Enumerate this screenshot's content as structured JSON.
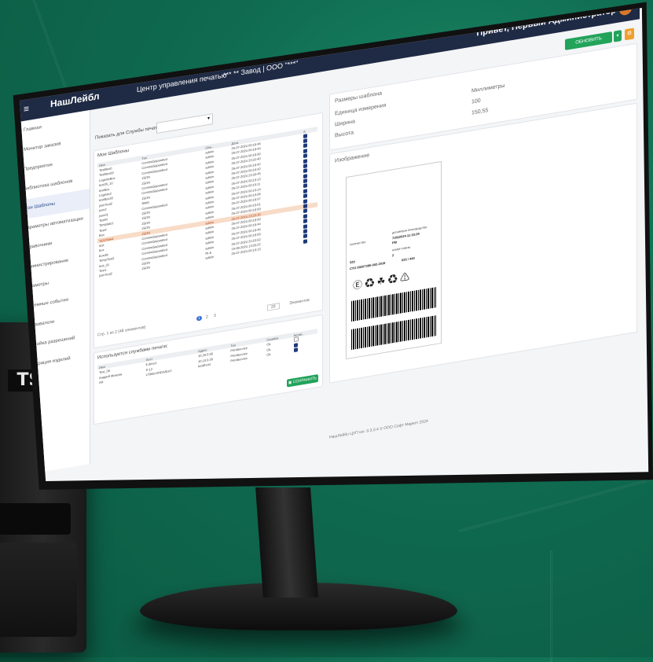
{
  "topbar": {
    "menu_icon": "≡",
    "brand": "НашЛейбл",
    "center": "Центр управления печатью",
    "plant": "*** ** Завод | ООО \"***\"",
    "greeting": "Привет, Первый Администратор"
  },
  "sidebar": {
    "items": [
      {
        "label": "Главная"
      },
      {
        "label": "Монитор заказов"
      },
      {
        "label": "Предприятие"
      },
      {
        "label": "Библиотека шаблонов"
      },
      {
        "label": "Мои Шаблоны"
      },
      {
        "label": "Параметры автоматизации"
      },
      {
        "label": "Справочники"
      },
      {
        "label": "Администрирование"
      },
      {
        "label": "Параметры"
      },
      {
        "label": "Системные события"
      },
      {
        "label": "Пользователи"
      },
      {
        "label": "Настройка разрешений"
      },
      {
        "label": "Регистрация изделий"
      }
    ]
  },
  "toolbar": {
    "update_label": "ОБНОВИТЬ",
    "dropdown": "▾",
    "gear": "⚙"
  },
  "filter": {
    "label": "Показать для Службы печати:",
    "value": ""
  },
  "templates": {
    "title": "Мои Шаблоны",
    "columns": [
      "Имя",
      "Тип",
      "Обн...",
      "Дата",
      "А"
    ],
    "rows": [
      {
        "name": "TestBox0",
        "type": "CommaSeparated",
        "user": "admin",
        "date": "25-07-2024 00:18:46",
        "active": true
      },
      {
        "name": "TestBox00",
        "type": "CommaSeparated",
        "user": "admin",
        "date": "25-07-2024 00:18:44",
        "active": true
      },
      {
        "name": "LogisticBox",
        "type": "CommaSeparated",
        "user": "admin",
        "date": "25-07-2024 00:18:50",
        "active": true
      },
      {
        "name": "test26_10",
        "type": "JSON",
        "user": "admin",
        "date": "25-07-2024 23:22:40",
        "active": true
      },
      {
        "name": "testBox",
        "type": "JSON",
        "user": "admin",
        "date": "25-07-2024 00:18:42",
        "active": true
      },
      {
        "name": "Logistic2",
        "type": "CommaSeparated",
        "user": "admin",
        "date": "25-07-2024 00:18:42",
        "active": true
      },
      {
        "name": "testBox30",
        "type": "CommaSeparated",
        "user": "admin",
        "date": "25-07-2024 23:33:45",
        "active": true
      },
      {
        "name": "jsonTest2",
        "type": "JSON",
        "user": "admin",
        "date": "25-07-2024 00:19:13",
        "active": true
      },
      {
        "name": "json2",
        "type": "Static",
        "user": "admin",
        "date": "25-07-2024 00:19:11",
        "active": true
      },
      {
        "name": "json01",
        "type": "CommaSeparated",
        "user": "admin",
        "date": "25-07-2024 00:19:14",
        "active": true
      },
      {
        "name": "TestM",
        "type": "JSON",
        "user": "admin",
        "date": "25-07-2024 00:19:06",
        "active": true
      },
      {
        "name": "Template1",
        "type": "JSON",
        "user": "admin",
        "date": "25-07-2024 00:18:57",
        "active": true
      },
      {
        "name": "Test4",
        "type": "JSON",
        "user": "admin",
        "date": "25-07-2024 00:19:01",
        "active": true
      },
      {
        "name": "Box",
        "type": "JSON",
        "user": "admin",
        "date": "25-07-2024 00:18:59",
        "active": true
      },
      {
        "name": "TESTMA4",
        "type": "JSON",
        "user": "admin",
        "date": "25-07-2024 23:23:30",
        "active": true,
        "highlight": true
      },
      {
        "name": "test",
        "type": "CommaSeparated",
        "user": "admin",
        "date": "25-07-2024 00:18:50",
        "active": true
      },
      {
        "name": "box",
        "type": "CommaSeparated",
        "user": "admin",
        "date": "25-07-2024 00:18:44",
        "active": true
      },
      {
        "name": "boxdle",
        "type": "CommaSeparated",
        "user": "admin",
        "date": "25-07-2024 00:18:46",
        "active": true
      },
      {
        "name": "TempTest2",
        "type": "CommaSeparated",
        "user": "admin",
        "date": "25-07-2024 00:18:59",
        "active": true
      },
      {
        "name": "test_01",
        "type": "CommaSeparated",
        "user": "admin",
        "date": "25-07-2024 23:23:52",
        "active": true
      },
      {
        "name": "Test1",
        "type": "JSON",
        "user": "NLS",
        "date": "19-08-2024 13:03:22",
        "active": true
      },
      {
        "name": "jsonTest2",
        "type": "JSON",
        "user": "admin",
        "date": "25-07-2024 00:19:13",
        "active": true
      }
    ],
    "pager": {
      "summary": "Стр. 1 из 2 (48 элементов)",
      "pages": [
        "1",
        "2",
        "3"
      ],
      "size": "20",
      "size_label": "Элементов"
    }
  },
  "services": {
    "title": "Используется службами печати:",
    "columns": [
      "Имя",
      "Хост",
      "Адрес",
      "Тип",
      "Ошибка",
      "Актив..."
    ],
    "rows": [
      {
        "name": "Test_06",
        "host": "ll-drive1",
        "addr": "10.20.0.56",
        "type": "PrintService",
        "err": "Ok",
        "active": false
      },
      {
        "name": "Андрей Михеев",
        "host": "Р-12",
        "addr": "10.10.0.26",
        "type": "PrintService",
        "err": "Ok",
        "active": true
      },
      {
        "name": "AR",
        "host": "LT888-OHDASGO",
        "addr": "localhost",
        "type": "PrintService",
        "err": "Ok",
        "active": true
      }
    ],
    "save_label": "СОХРАНИТЬ"
  },
  "sizes": {
    "title": "Размеры шаблона",
    "units_label": "Единица измерения",
    "units_value": "Миллиметры",
    "width_label": "Ширина",
    "width_value": "100",
    "height_label": "Высота",
    "height_value": "150,55"
  },
  "image": {
    "title": "Изображение",
    "label_texts": [
      "ДАТА/ВРЕМЯ ПРОИЗВОДСТВА",
      "7/26/2024 11:33:29",
      "PM",
      "КОЛИЧЕСТВО",
      "НОМЕР СМЕНЫ",
      "2",
      "СТО 00207385-002-2016",
      "025 / 440",
      "320"
    ]
  },
  "footer": "НашЛейбл ЦУП ver. 0.3.0.4 © ООО Софт Маркет 2024"
}
